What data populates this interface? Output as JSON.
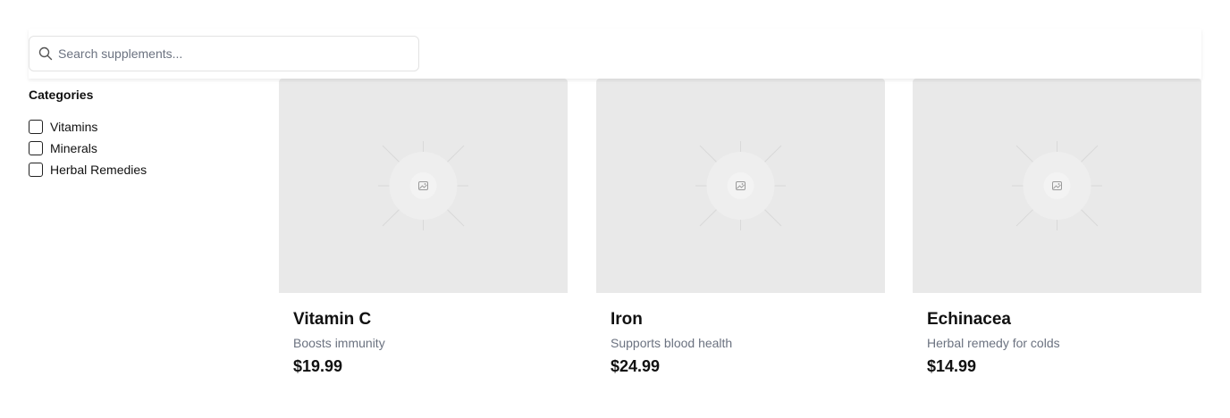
{
  "search": {
    "placeholder": "Search supplements...",
    "icon": "search-icon"
  },
  "sidebar": {
    "title": "Categories",
    "categories": [
      {
        "label": "Vitamins",
        "checked": false
      },
      {
        "label": "Minerals",
        "checked": false
      },
      {
        "label": "Herbal Remedies",
        "checked": false
      }
    ]
  },
  "products": [
    {
      "name": "Vitamin C",
      "description": "Boosts immunity",
      "price": "$19.99",
      "image_icon": "image-placeholder-icon"
    },
    {
      "name": "Iron",
      "description": "Supports blood health",
      "price": "$24.99",
      "image_icon": "image-placeholder-icon"
    },
    {
      "name": "Echinacea",
      "description": "Herbal remedy for colds",
      "price": "$14.99",
      "image_icon": "image-placeholder-icon"
    }
  ],
  "colors": {
    "placeholder_bg": "#e9e9e9",
    "muted_text": "#6b7280",
    "text": "#111111"
  }
}
